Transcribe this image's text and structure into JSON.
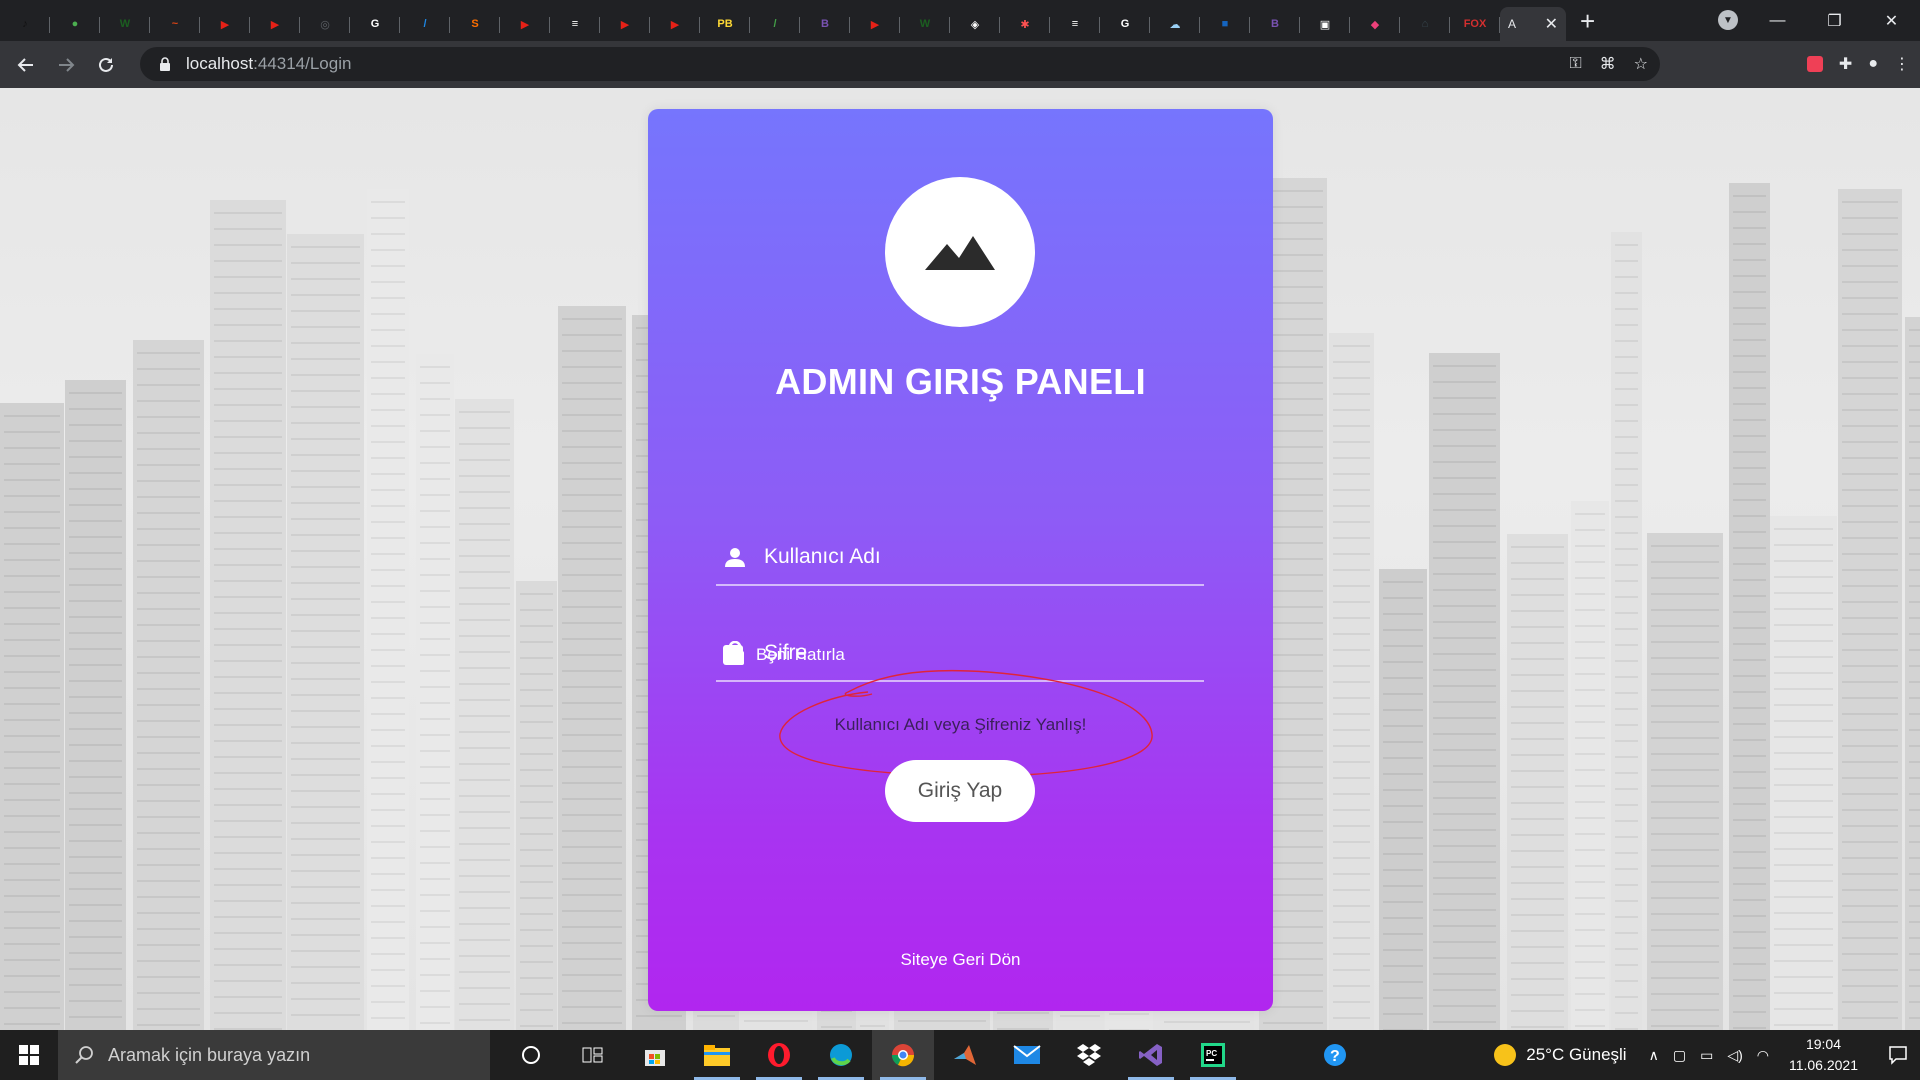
{
  "browser": {
    "tabs": [
      {
        "icon": "tiktok-icon",
        "glyph": "♪",
        "color": "#111111"
      },
      {
        "icon": "leaf-icon",
        "glyph": "●",
        "color": "#4caf50"
      },
      {
        "icon": "w-icon",
        "glyph": "W",
        "color": "#1b5e20"
      },
      {
        "icon": "swoosh-icon",
        "glyph": "~",
        "color": "#d84315"
      },
      {
        "icon": "youtube-icon",
        "glyph": "▶",
        "color": "#e62117"
      },
      {
        "icon": "youtube-icon",
        "glyph": "▶",
        "color": "#e62117"
      },
      {
        "icon": "globe-icon",
        "glyph": "◎",
        "color": "#5f6368"
      },
      {
        "icon": "google-icon",
        "glyph": "G",
        "color": "#ffffff"
      },
      {
        "icon": "feather-icon",
        "glyph": "/",
        "color": "#1e88e5"
      },
      {
        "icon": "sublime-icon",
        "glyph": "S",
        "color": "#ff6f00"
      },
      {
        "icon": "youtube-icon",
        "glyph": "▶",
        "color": "#e62117"
      },
      {
        "icon": "stack-icon",
        "glyph": "≡",
        "color": "#ffffff"
      },
      {
        "icon": "youtube-icon",
        "glyph": "▶",
        "color": "#e62117"
      },
      {
        "icon": "youtube-icon",
        "glyph": "▶",
        "color": "#e62117"
      },
      {
        "icon": "pb-icon",
        "glyph": "PB",
        "color": "#fdd835"
      },
      {
        "icon": "leaf-icon",
        "glyph": "/",
        "color": "#43a047"
      },
      {
        "icon": "bootstrap-icon",
        "glyph": "B",
        "color": "#7952b3"
      },
      {
        "icon": "youtube-icon",
        "glyph": "▶",
        "color": "#e62117"
      },
      {
        "icon": "w-icon",
        "glyph": "W",
        "color": "#1b5e20"
      },
      {
        "icon": "codepen-icon",
        "glyph": "◈",
        "color": "#ffffff"
      },
      {
        "icon": "asterisk-icon",
        "glyph": "✱",
        "color": "#ff5252"
      },
      {
        "icon": "stack-icon",
        "glyph": "≡",
        "color": "#ffffff"
      },
      {
        "icon": "google-icon",
        "glyph": "G",
        "color": "#ffffff"
      },
      {
        "icon": "cloud-icon",
        "glyph": "☁",
        "color": "#9ad0f5"
      },
      {
        "icon": "square-icon",
        "glyph": "■",
        "color": "#1565c0"
      },
      {
        "icon": "bootstrap-icon",
        "glyph": "B",
        "color": "#7952b3"
      },
      {
        "icon": "image-icon",
        "glyph": "▣",
        "color": "#ffffff"
      },
      {
        "icon": "gradient-icon",
        "glyph": "◆",
        "color": "#ec407a"
      },
      {
        "icon": "house-icon",
        "glyph": "⌂",
        "color": "#37474f"
      },
      {
        "icon": "fox-icon",
        "glyph": "FOX",
        "color": "#d32f2f"
      }
    ],
    "active_tab": {
      "title": "A",
      "close": "✕"
    },
    "new_tab": "+",
    "url_host": "localhost",
    "url_rest": ":44314/Login",
    "window": {
      "minimize": "—",
      "maximize": "❐",
      "close": "✕"
    }
  },
  "login": {
    "title": "ADMIN GIRIŞ PANELI",
    "username_placeholder": "Kullanıcı Adı",
    "password_placeholder": "Şifre",
    "remember_label": "Beni Hatırla",
    "error_message": "Kullanıcı Adı veya Şifreniz Yanlış!",
    "submit_label": "Giriş Yap",
    "back_link": "Siteye Geri Dön"
  },
  "colors": {
    "card_top": "#7675fd",
    "card_bottom": "#b126ef",
    "annotation": "#e0243a"
  },
  "taskbar": {
    "search_placeholder": "Aramak için buraya yazın",
    "weather": "25°C  Güneşli",
    "time": "19:04",
    "date": "11.06.2021"
  }
}
